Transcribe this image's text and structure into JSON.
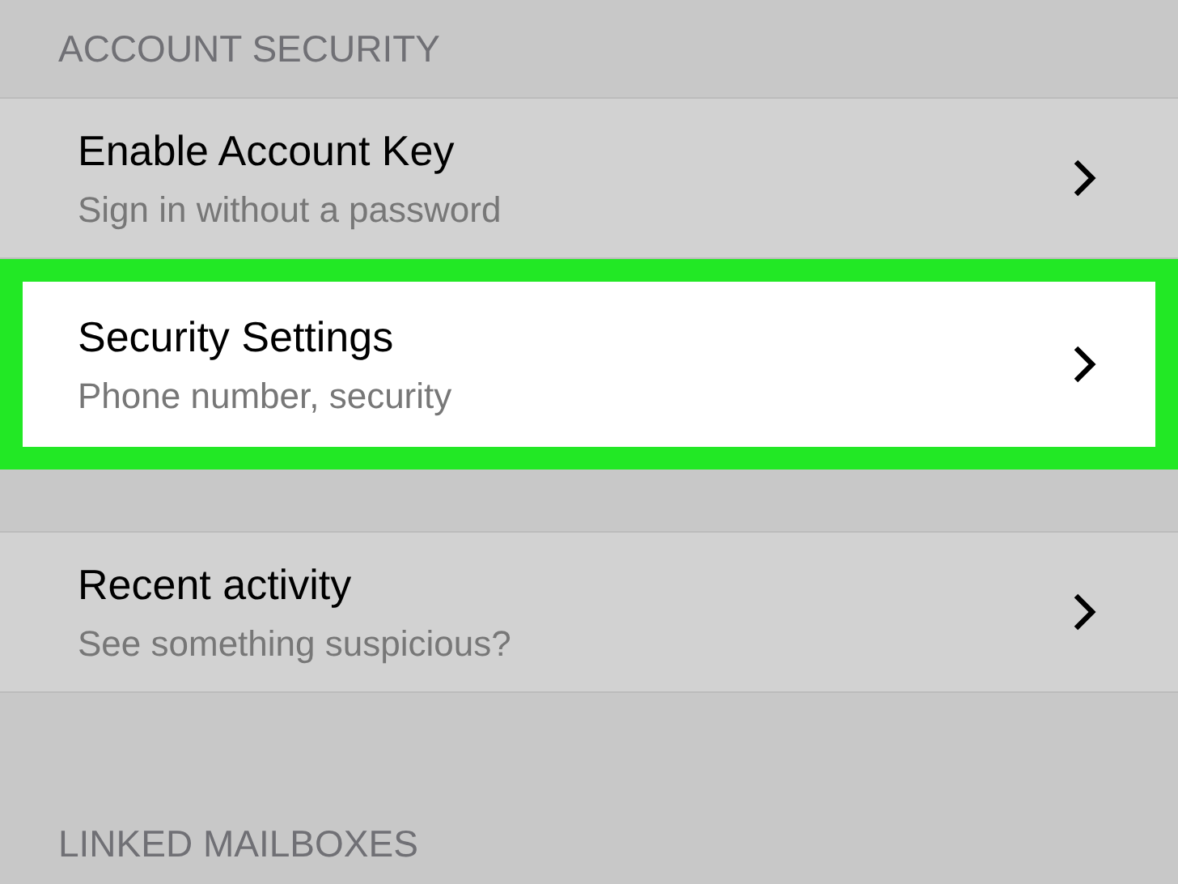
{
  "sections": [
    {
      "header": "ACCOUNT SECURITY",
      "rows": [
        {
          "title": "Enable Account Key",
          "subtitle": "Sign in without a password",
          "selected": false
        },
        {
          "title": "Security Settings",
          "subtitle": "Phone number, security",
          "selected": true
        }
      ]
    },
    {
      "rows": [
        {
          "title": "Recent activity",
          "subtitle": "See something suspicious?",
          "selected": false
        }
      ]
    },
    {
      "header": "LINKED MAILBOXES"
    }
  ]
}
